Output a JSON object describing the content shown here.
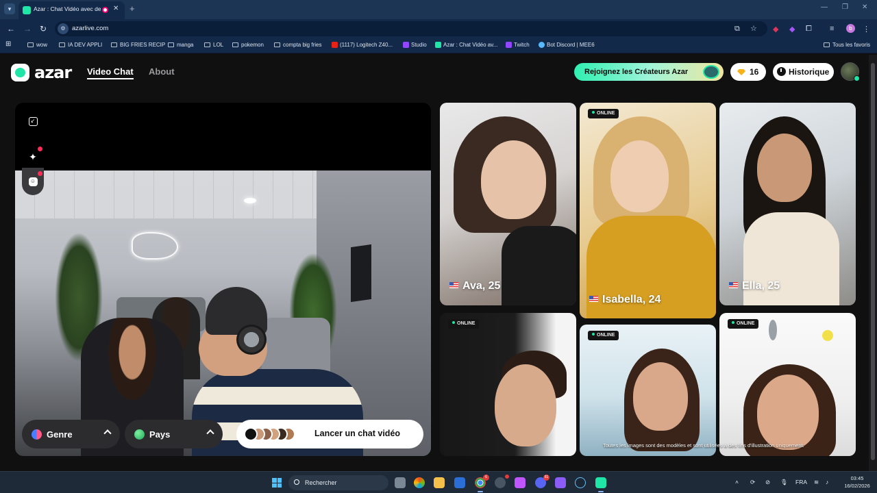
{
  "browser": {
    "tab_title": "Azar : Chat Vidéo avec de n",
    "url": "azarlive.com",
    "bookmarks": [
      "wow",
      "IA DEV APPLI",
      "BIG FRIES RECIP",
      "manga",
      "LOL",
      "pokemon",
      "compta big fries",
      "(1117) Logitech Z40...",
      "Studio",
      "Azar : Chat Vidéo av...",
      "Twitch",
      "Bot Discord | MEE6"
    ],
    "all_bookmarks": "Tous les favoris",
    "profile_initial": "b"
  },
  "header": {
    "logo": "azar",
    "nav": [
      "Video Chat",
      "About"
    ],
    "creators_button": "Rejoignez les Créateurs Azar",
    "gems": "16",
    "history_button": "Historique"
  },
  "video": {
    "filters": {
      "genre": "Genre",
      "pays": "Pays"
    },
    "start_button": "Lancer un chat vidéo"
  },
  "models": {
    "online_label": "ONLINE",
    "cards": [
      {
        "name": "Ava, 25",
        "online": false
      },
      {
        "name": "Isabella, 24",
        "online": true
      },
      {
        "name": "Ella, 25",
        "online": false
      },
      {
        "name": "",
        "online": true
      },
      {
        "name": "",
        "online": true
      },
      {
        "name": "",
        "online": true
      }
    ],
    "disclaimer": "Toutes les images sont des modèles et sont utilisées à des fins d'illustration uniquement."
  },
  "taskbar": {
    "search_placeholder": "Rechercher",
    "language": "FRA",
    "time": "03:45",
    "date": "16/02/2026",
    "badges": {
      "chrome": "6",
      "discord": "81"
    }
  },
  "colors": {
    "accent": "#1fe5a7",
    "page_bg": "#101011",
    "browser_chrome": "#12294a",
    "taskbar": "#1e2a38"
  }
}
